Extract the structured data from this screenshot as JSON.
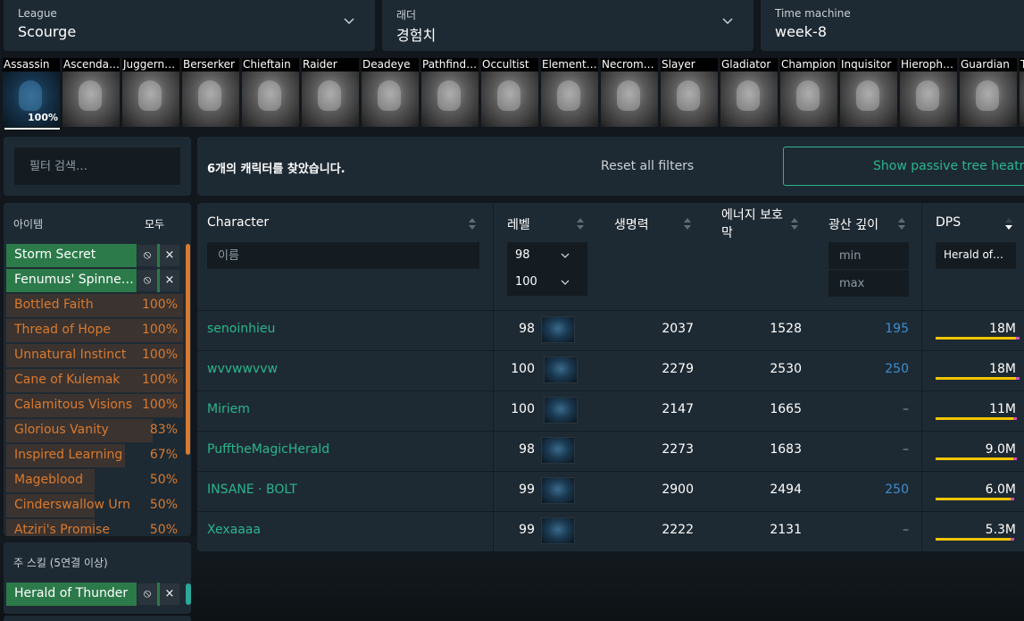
{
  "filters": {
    "league": {
      "label": "League",
      "value": "Scourge"
    },
    "ladder": {
      "label": "래더",
      "value": "경험치"
    },
    "time_machine": {
      "label": "Time machine",
      "value": "week-8"
    }
  },
  "classes": [
    {
      "name": "Assassin",
      "pct": "100%",
      "active": true
    },
    {
      "name": "Ascenda…"
    },
    {
      "name": "Juggern…"
    },
    {
      "name": "Berserker"
    },
    {
      "name": "Chieftain"
    },
    {
      "name": "Raider"
    },
    {
      "name": "Deadeye"
    },
    {
      "name": "Pathfind…"
    },
    {
      "name": "Occultist"
    },
    {
      "name": "Element…"
    },
    {
      "name": "Necrom…"
    },
    {
      "name": "Slayer"
    },
    {
      "name": "Gladiator"
    },
    {
      "name": "Champion"
    },
    {
      "name": "Inquisitor"
    },
    {
      "name": "Hieroph…"
    },
    {
      "name": "Guardian"
    },
    {
      "name": "T"
    }
  ],
  "sidebar": {
    "filter_placeholder": "필터 검색…",
    "items_title": "아이템",
    "items_all": "모두",
    "selected_items": [
      "Storm Secret",
      "Fenumus' Spinner…"
    ],
    "items": [
      {
        "name": "Bottled Faith",
        "pct": "100%",
        "share": 1.0
      },
      {
        "name": "Thread of Hope",
        "pct": "100%",
        "share": 1.0
      },
      {
        "name": "Unnatural Instinct",
        "pct": "100%",
        "share": 1.0
      },
      {
        "name": "Cane of Kulemak",
        "pct": "100%",
        "share": 1.0
      },
      {
        "name": "Calamitous Visions",
        "pct": "100%",
        "share": 1.0
      },
      {
        "name": "Glorious Vanity",
        "pct": "83%",
        "share": 0.83
      },
      {
        "name": "Inspired Learning",
        "pct": "67%",
        "share": 0.67
      },
      {
        "name": "Mageblood",
        "pct": "50%",
        "share": 0.5
      },
      {
        "name": "Cinderswallow Urn",
        "pct": "50%",
        "share": 0.5
      },
      {
        "name": "Atziri's Promise",
        "pct": "50%",
        "share": 0.5
      }
    ],
    "skills_title": "주 스킬 (5연결 이상)",
    "selected_skill": "Herald of Thunder",
    "ban_glyph": "⦸",
    "remove_glyph": "×"
  },
  "results": {
    "found_text": "6개의 캐릭터를 찾았습니다.",
    "reset_label": "Reset all filters",
    "heatmap_label": "Show passive tree heatmap"
  },
  "table": {
    "headers": {
      "character": "Character",
      "level": "레벨",
      "life": "생명력",
      "es_line1": "에너지 보호",
      "es_line2": "막",
      "depth": "광산 깊이",
      "dps": "DPS"
    },
    "name_placeholder": "이름",
    "level_min": "98",
    "level_max": "100",
    "depth_min_placeholder": "min",
    "depth_max_placeholder": "max",
    "dps_skill": "Herald of…",
    "rows": [
      {
        "name": "senoinhieu",
        "level": "98",
        "life": "2037",
        "es": "1528",
        "depth": "195",
        "dps": "18M",
        "dps_share": 1.0
      },
      {
        "name": "wvvwwvvw",
        "level": "100",
        "life": "2279",
        "es": "2530",
        "depth": "250",
        "dps": "18M",
        "dps_share": 1.0
      },
      {
        "name": "Miriem",
        "level": "100",
        "life": "2147",
        "es": "1665",
        "depth": "–",
        "dps": "11M",
        "dps_share": 0.97
      },
      {
        "name": "PufftheMagicHerald",
        "level": "98",
        "life": "2273",
        "es": "1683",
        "depth": "–",
        "dps": "9.0M",
        "dps_share": 0.97
      },
      {
        "name": "INSANE · BOLT",
        "level": "99",
        "life": "2900",
        "es": "2494",
        "depth": "250",
        "dps": "6.0M",
        "dps_share": 0.93
      },
      {
        "name": "Xexaaaa",
        "level": "99",
        "life": "2222",
        "es": "2131",
        "depth": "–",
        "dps": "5.3M",
        "dps_share": 0.93
      }
    ]
  },
  "colors": {
    "accent_green": "#2bb58e",
    "orange": "#d97a2f",
    "dps_bar": "#f2c500",
    "depth_blue": "#3d8ed1"
  }
}
